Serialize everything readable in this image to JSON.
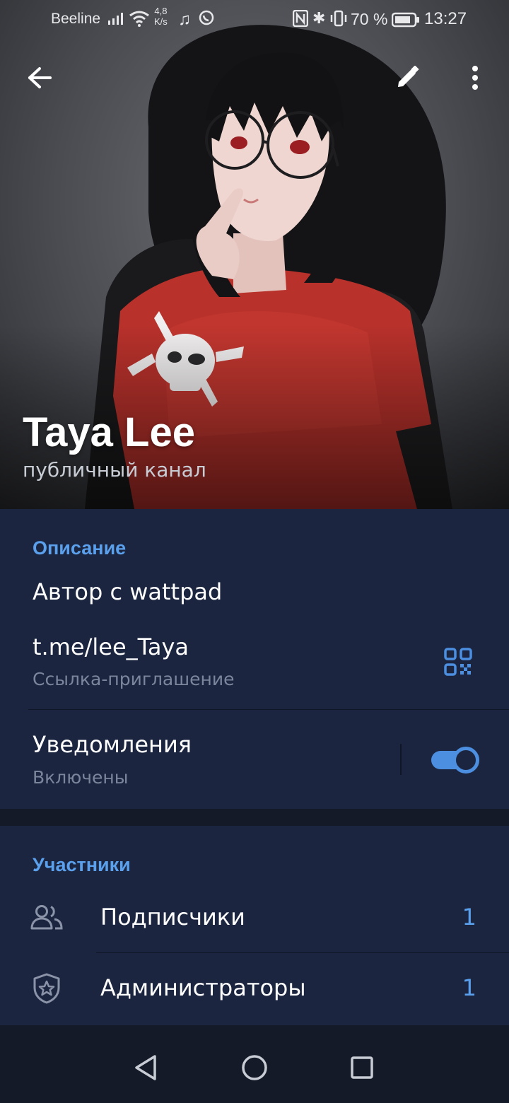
{
  "status_bar": {
    "carrier": "Beeline",
    "net_speed_value": "4,8",
    "net_speed_unit": "K/s",
    "battery_percent": "70 %",
    "time": "13:27"
  },
  "header": {
    "channel_name": "Taya Lee",
    "channel_type": "публичный канал"
  },
  "info": {
    "section_title": "Описание",
    "description": "Автор с wattpad",
    "link": "t.me/lee_Taya",
    "link_caption": "Ссылка-приглашение",
    "notifications_label": "Уведомления",
    "notifications_state": "Включены",
    "notifications_enabled": true
  },
  "members": {
    "section_title": "Участники",
    "rows": [
      {
        "label": "Подписчики",
        "count": "1",
        "icon": "people-icon"
      },
      {
        "label": "Администраторы",
        "count": "1",
        "icon": "shield-star-icon"
      }
    ]
  },
  "colors": {
    "accent": "#5aa0ec",
    "card_bg": "#1b2540",
    "page_bg": "#141a28",
    "secondary_text": "#7b859b"
  }
}
